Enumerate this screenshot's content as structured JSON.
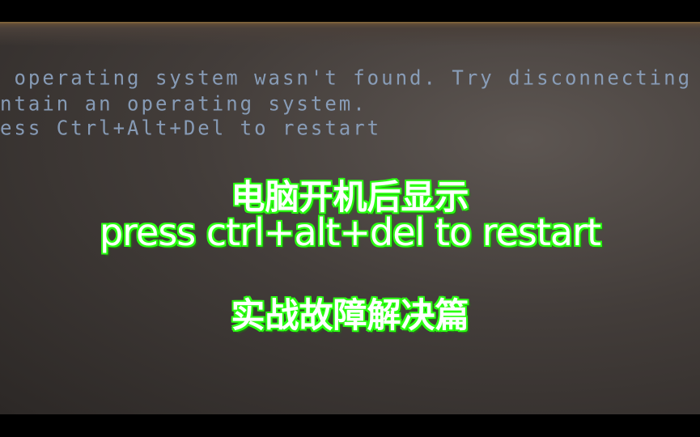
{
  "screen": {
    "lines": [
      " operating system wasn't found. Try disconnecting",
      "ntain an operating system.",
      "ess Ctrl+Alt+Del to restart"
    ],
    "text_color": "#8fa6c4"
  },
  "overlay": {
    "title_line1": "电脑开机后显示",
    "title_line2": "press ctrl+alt+del to restart",
    "subtitle": "实战故障解决篇",
    "text_color": "#ffffff",
    "outline_color": "#2bff12"
  }
}
